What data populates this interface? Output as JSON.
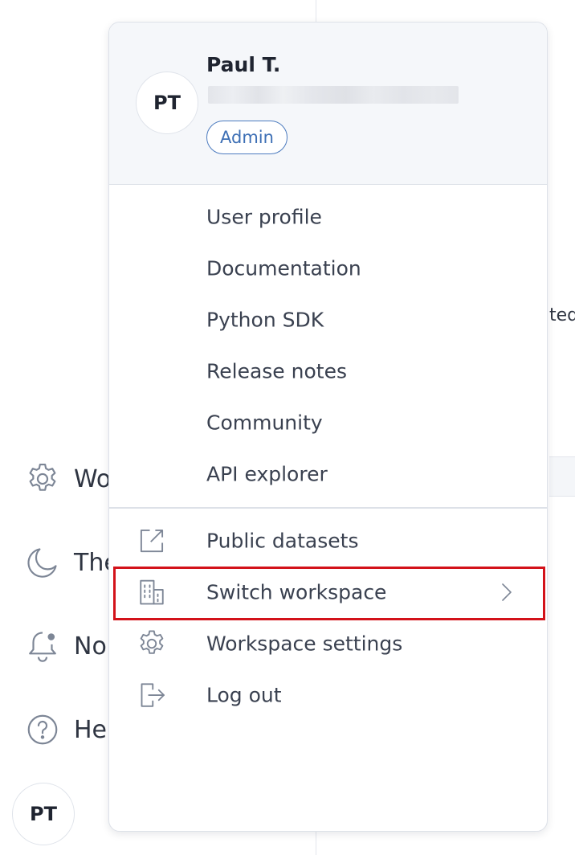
{
  "user": {
    "name": "Paul T.",
    "initials": "PT",
    "role_badge": "Admin"
  },
  "menu": {
    "links": [
      {
        "label": "User profile"
      },
      {
        "label": "Documentation"
      },
      {
        "label": "Python SDK"
      },
      {
        "label": "Release notes"
      },
      {
        "label": "Community"
      },
      {
        "label": "API explorer"
      }
    ],
    "actions": [
      {
        "label": "Public datasets",
        "icon": "external-link-icon"
      },
      {
        "label": "Switch workspace",
        "icon": "building-icon",
        "has_submenu": true
      },
      {
        "label": "Workspace settings",
        "icon": "gear-icon"
      },
      {
        "label": "Log out",
        "icon": "logout-icon"
      }
    ]
  },
  "sidebar": {
    "items": [
      {
        "label": "Wo",
        "icon": "gear-icon"
      },
      {
        "label": "The",
        "icon": "moon-icon"
      },
      {
        "label": "No",
        "icon": "bell-icon"
      },
      {
        "label": "He",
        "icon": "help-icon"
      }
    ],
    "avatar_initials": "PT"
  },
  "background": {
    "partial_text": "ted"
  },
  "colors": {
    "accent": "#3d6fb5",
    "highlight": "#d3121a",
    "icon": "#7d8696",
    "header_bg": "#f5f7fa"
  }
}
